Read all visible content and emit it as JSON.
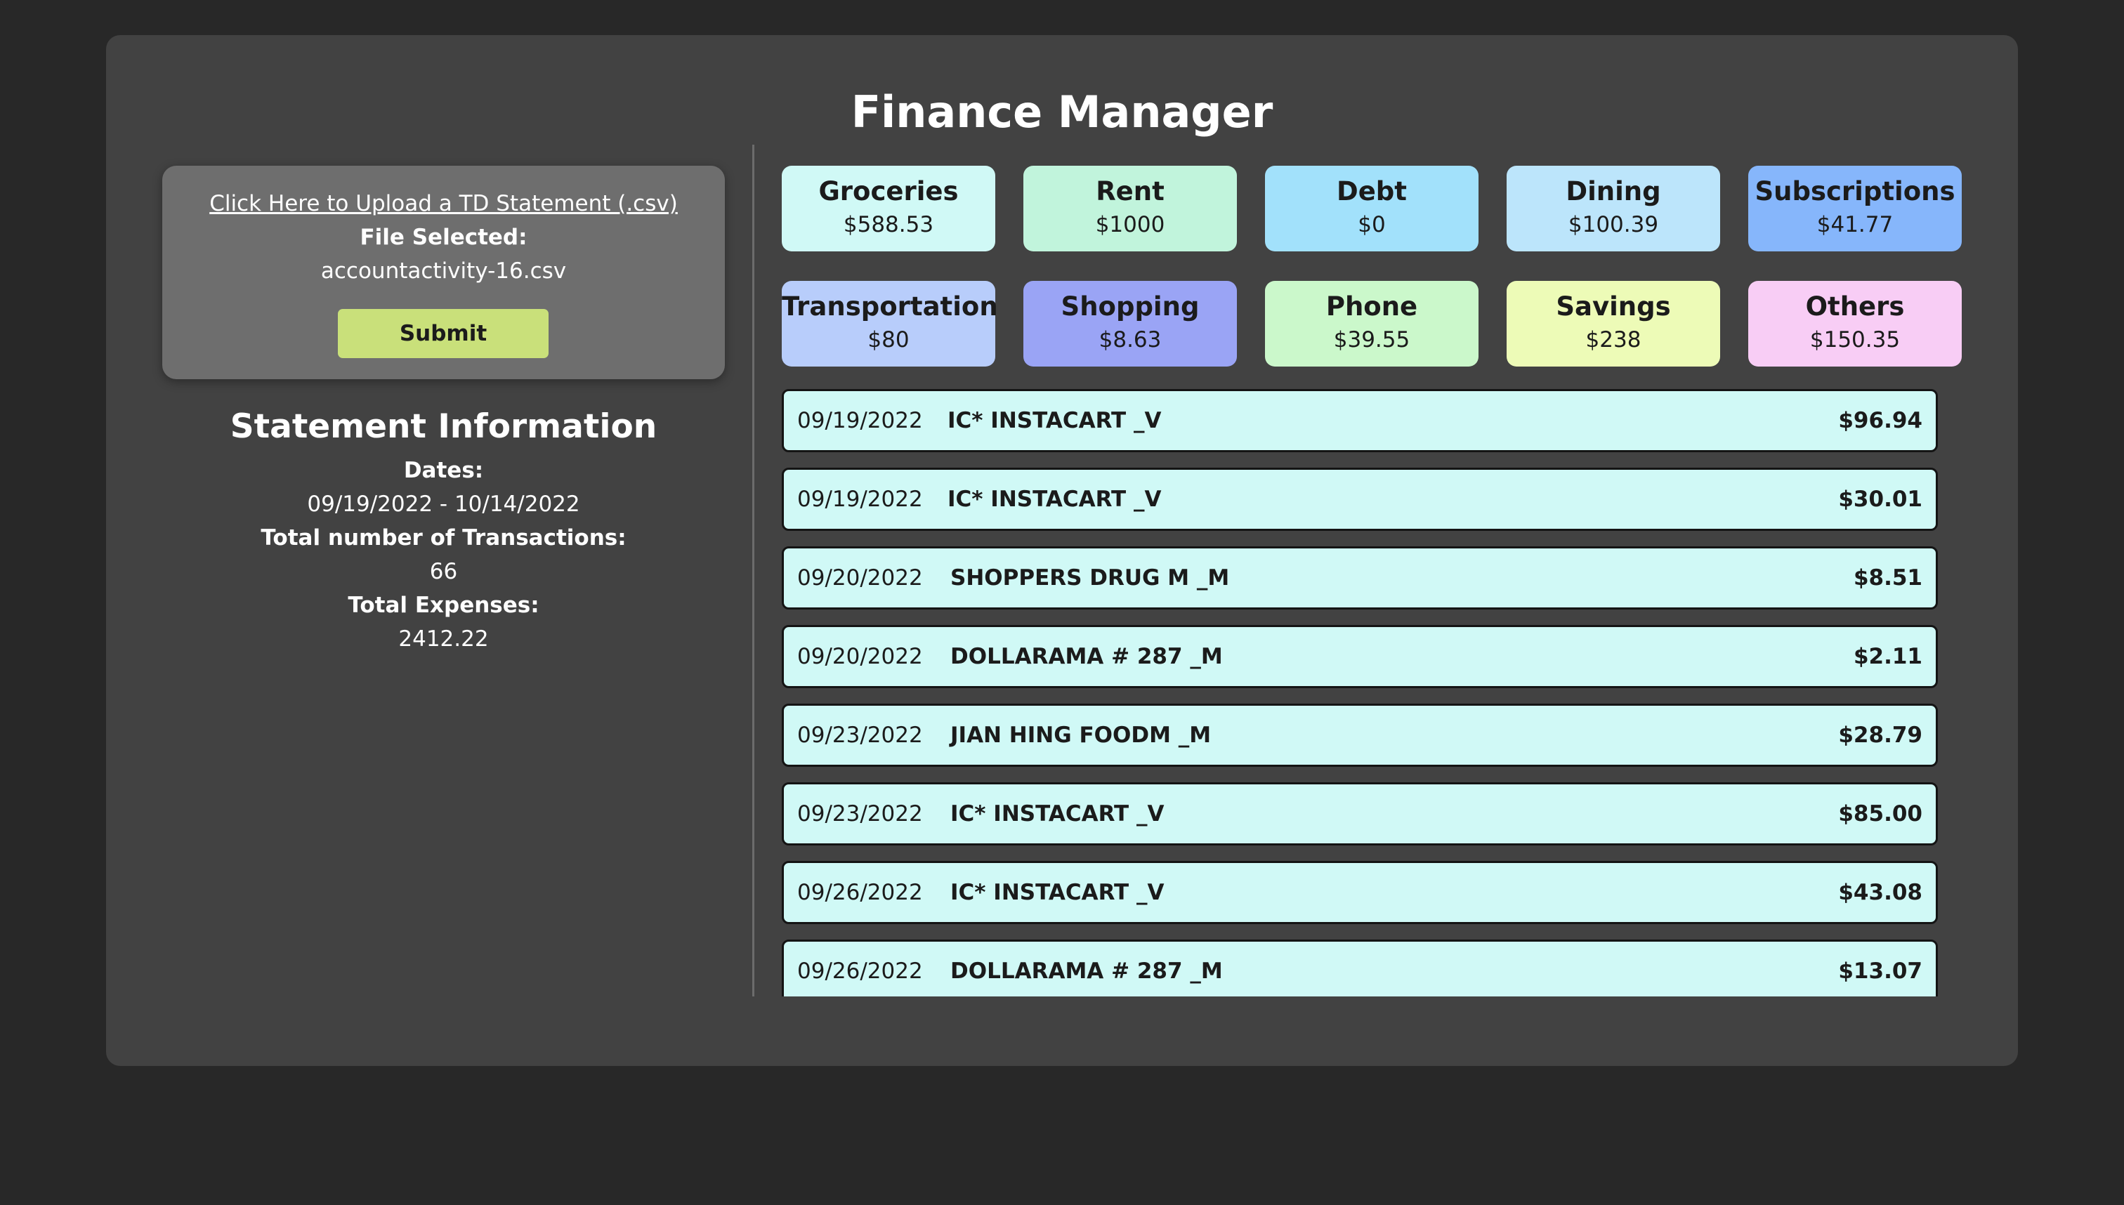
{
  "app": {
    "title": "Finance Manager"
  },
  "upload": {
    "link_label": "Click Here to Upload a TD Statement (.csv)",
    "file_label": "File Selected:",
    "file_name": "accountactivity-16.csv",
    "submit_label": "Submit"
  },
  "statement": {
    "title": "Statement Information",
    "dates_label": "Dates:",
    "dates_value": "09/19/2022 - 10/14/2022",
    "count_label": "Total number of Transactions:",
    "count_value": "66",
    "expenses_label": "Total Expenses:",
    "expenses_value": "2412.22"
  },
  "categories": [
    {
      "name": "Groceries",
      "amount": "$588.53",
      "color": "#d0f9f6"
    },
    {
      "name": "Rent",
      "amount": "$1000",
      "color": "#c1f4dc"
    },
    {
      "name": "Debt",
      "amount": "$0",
      "color": "#a2e1fb"
    },
    {
      "name": "Dining",
      "amount": "$100.39",
      "color": "#bce5fb"
    },
    {
      "name": "Subscriptions",
      "amount": "$41.77",
      "color": "#86b6fb"
    },
    {
      "name": "Transportation",
      "amount": "$80",
      "color": "#b8cdfb"
    },
    {
      "name": "Shopping",
      "amount": "$8.63",
      "color": "#9aa4f5"
    },
    {
      "name": "Phone",
      "amount": "$39.55",
      "color": "#cbf8cb"
    },
    {
      "name": "Savings",
      "amount": "$238",
      "color": "#edfbb7"
    },
    {
      "name": "Others",
      "amount": "$150.35",
      "color": "#f8cdf5"
    }
  ],
  "transactions": [
    {
      "date": "09/19/2022",
      "description": "IC* INSTACART _V",
      "amount": "$96.94"
    },
    {
      "date": "09/19/2022",
      "description": "IC* INSTACART _V",
      "amount": "$30.01"
    },
    {
      "date": "09/20/2022",
      "description": "SHOPPERS DRUG M _M",
      "amount": "$8.51"
    },
    {
      "date": "09/20/2022",
      "description": "DOLLARAMA # 287 _M",
      "amount": "$2.11"
    },
    {
      "date": "09/23/2022",
      "description": "JIAN HING FOODM _M",
      "amount": "$28.79"
    },
    {
      "date": "09/23/2022",
      "description": "IC* INSTACART _V",
      "amount": "$85.00"
    },
    {
      "date": "09/26/2022",
      "description": "IC* INSTACART _V",
      "amount": "$43.08"
    },
    {
      "date": "09/26/2022",
      "description": "DOLLARAMA # 287 _M",
      "amount": "$13.07"
    }
  ]
}
